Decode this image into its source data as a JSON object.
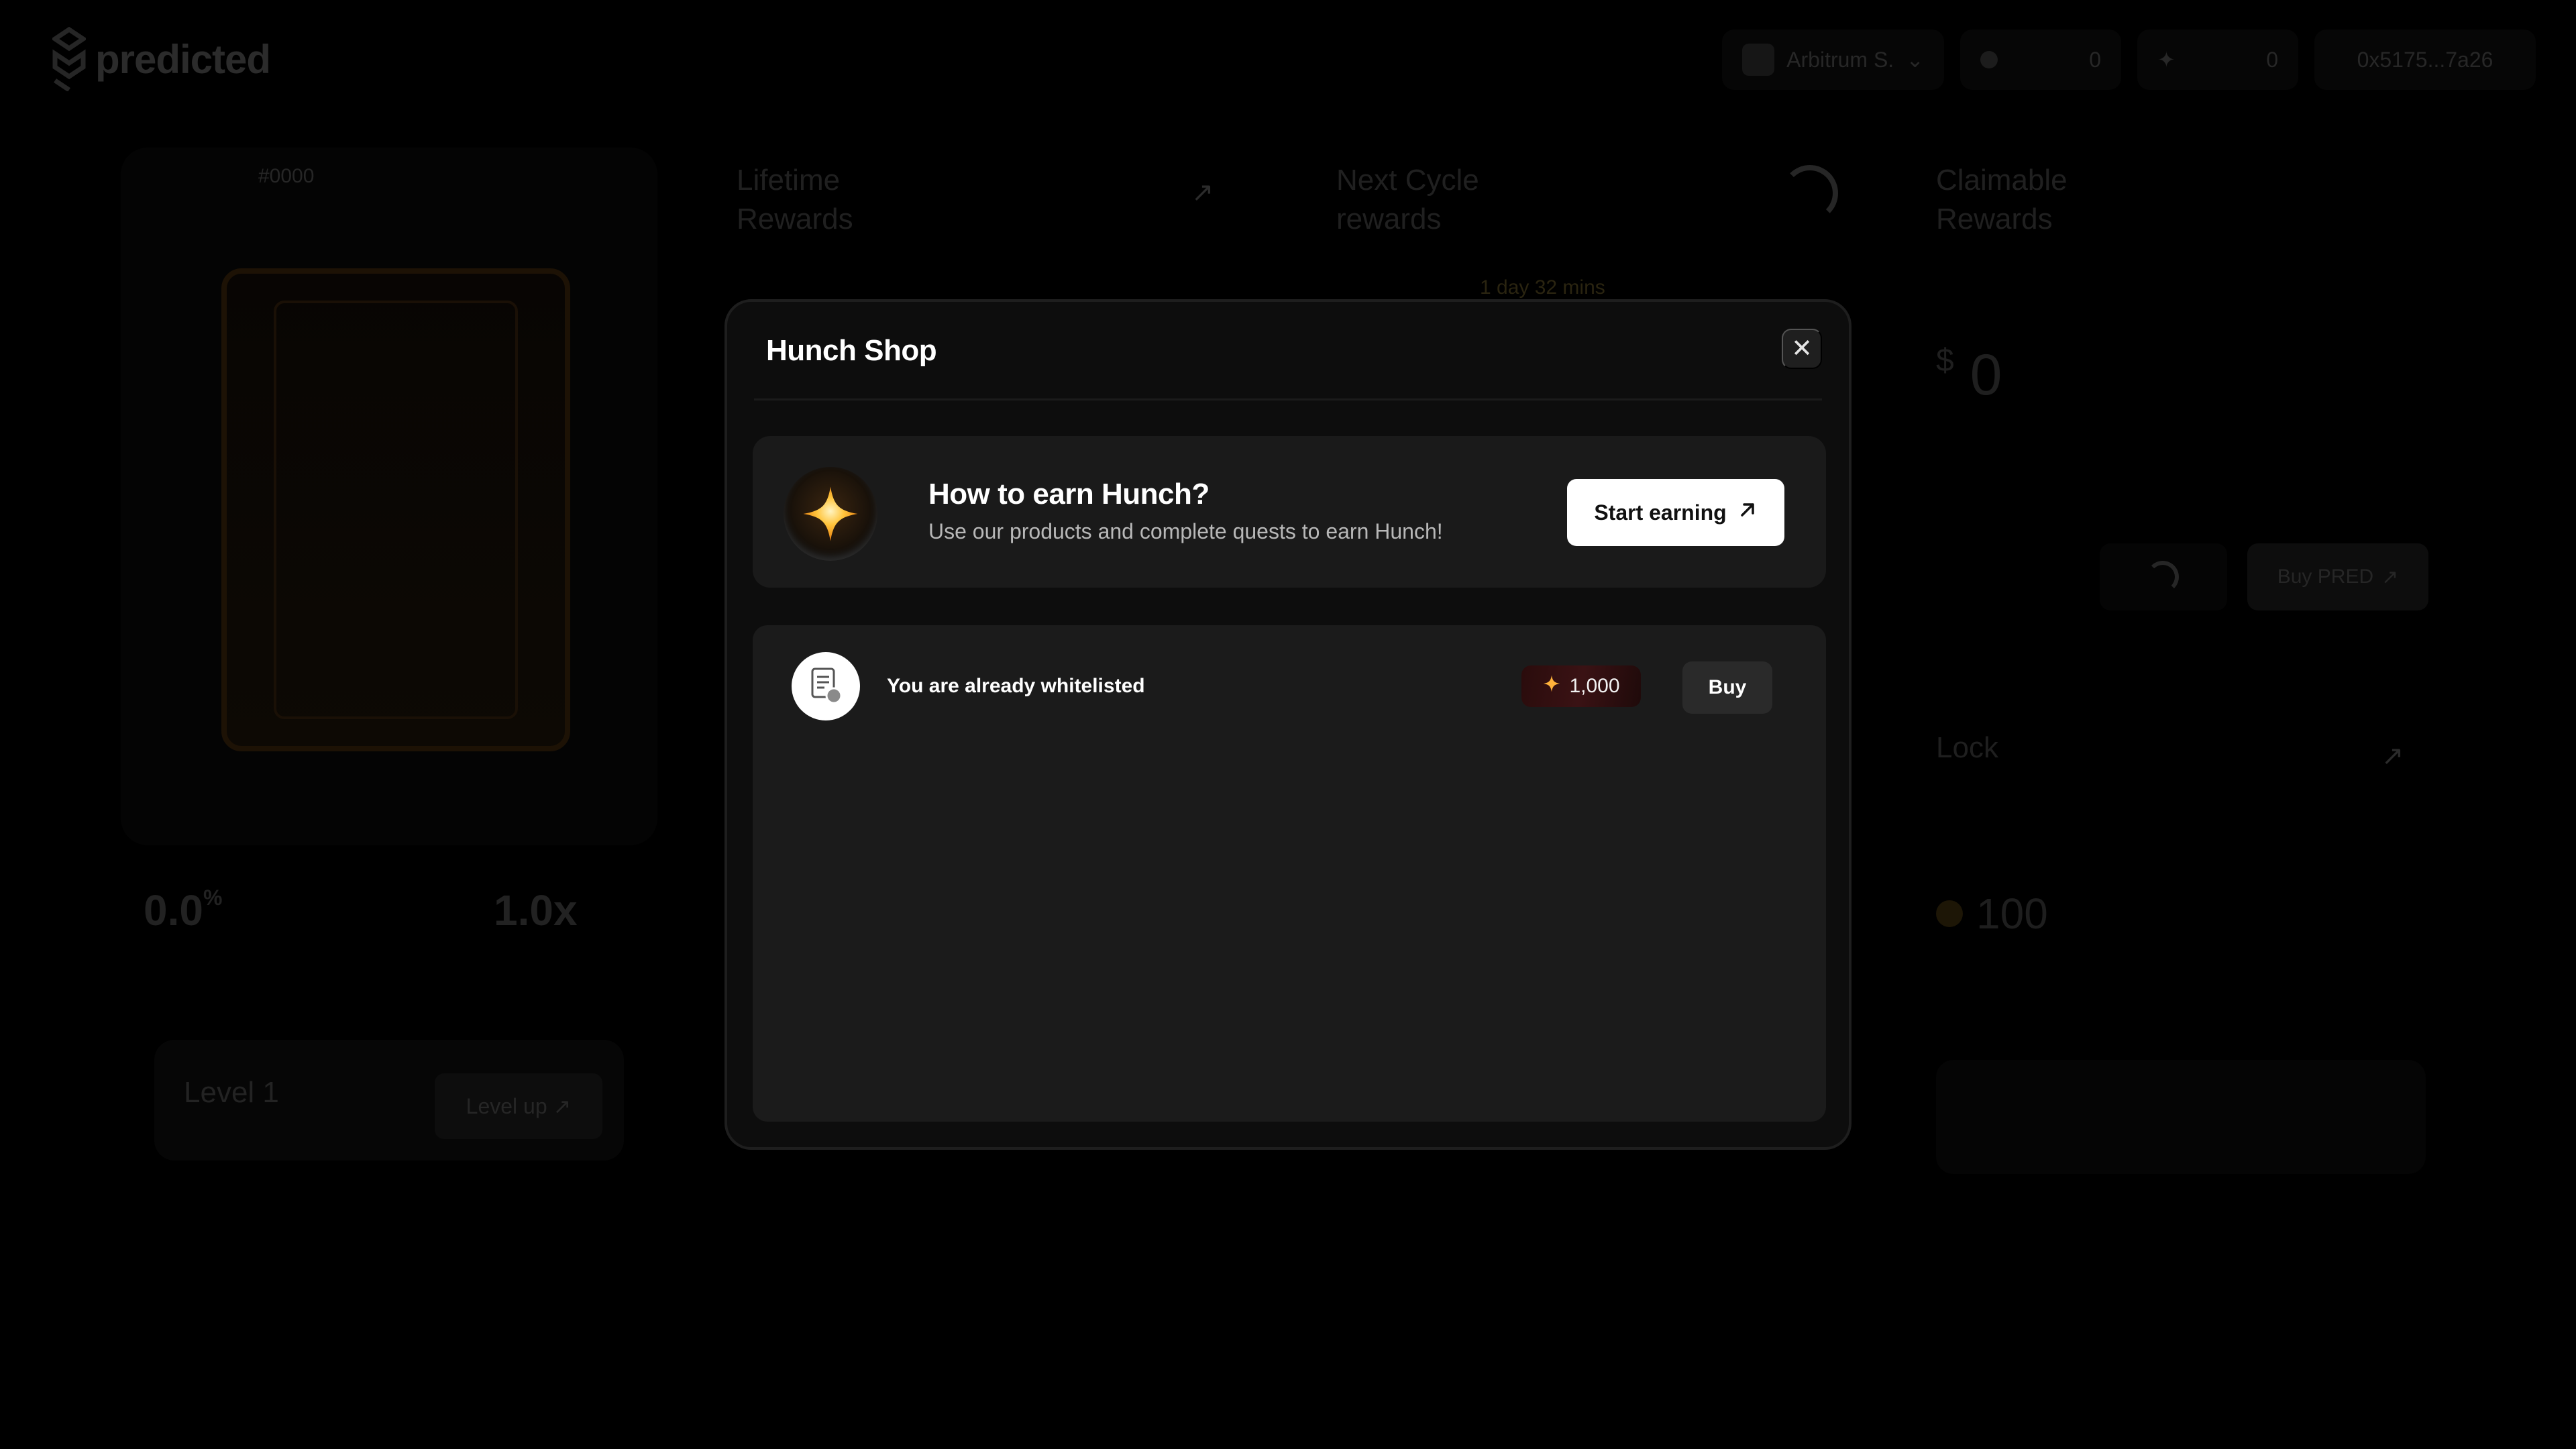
{
  "app": {
    "logo_text": "predicted"
  },
  "topbar": {
    "network_label": "Arbitrum S.",
    "balance_1": "0",
    "balance_2": "0",
    "wallet_address": "0x5175...7a26"
  },
  "background": {
    "nft_id": "#0000",
    "lifetime_rewards_title": "Lifetime Rewards",
    "next_cycle_title": "Next Cycle rewards",
    "next_cycle_countdown": "1 day 32 mins",
    "claimable_title": "Claimable Rewards",
    "claimable_currency": "$",
    "claimable_value": "0",
    "nft_boost_value": "0.0",
    "nft_boost_unit": "%",
    "multiplier_value": "1.0x",
    "level_title": "Level 1",
    "level_up_label": "Level up",
    "buy_pred_label": "Buy PRED",
    "lock_title": "Lock",
    "lock_value": "100"
  },
  "modal": {
    "title": "Hunch Shop",
    "close_glyph": "✕",
    "earn": {
      "title": "How to earn Hunch?",
      "subtitle": "Use our products and complete quests to earn Hunch!",
      "button_label": "Start earning"
    },
    "items": [
      {
        "label": "You are already whitelisted",
        "price": "1,000",
        "buy_label": "Buy"
      }
    ]
  },
  "colors": {
    "modal_bg": "#0d0d0d",
    "card_bg": "#1a1a1a",
    "accent_orange": "#f5a623",
    "price_badge": "#3a1214"
  }
}
